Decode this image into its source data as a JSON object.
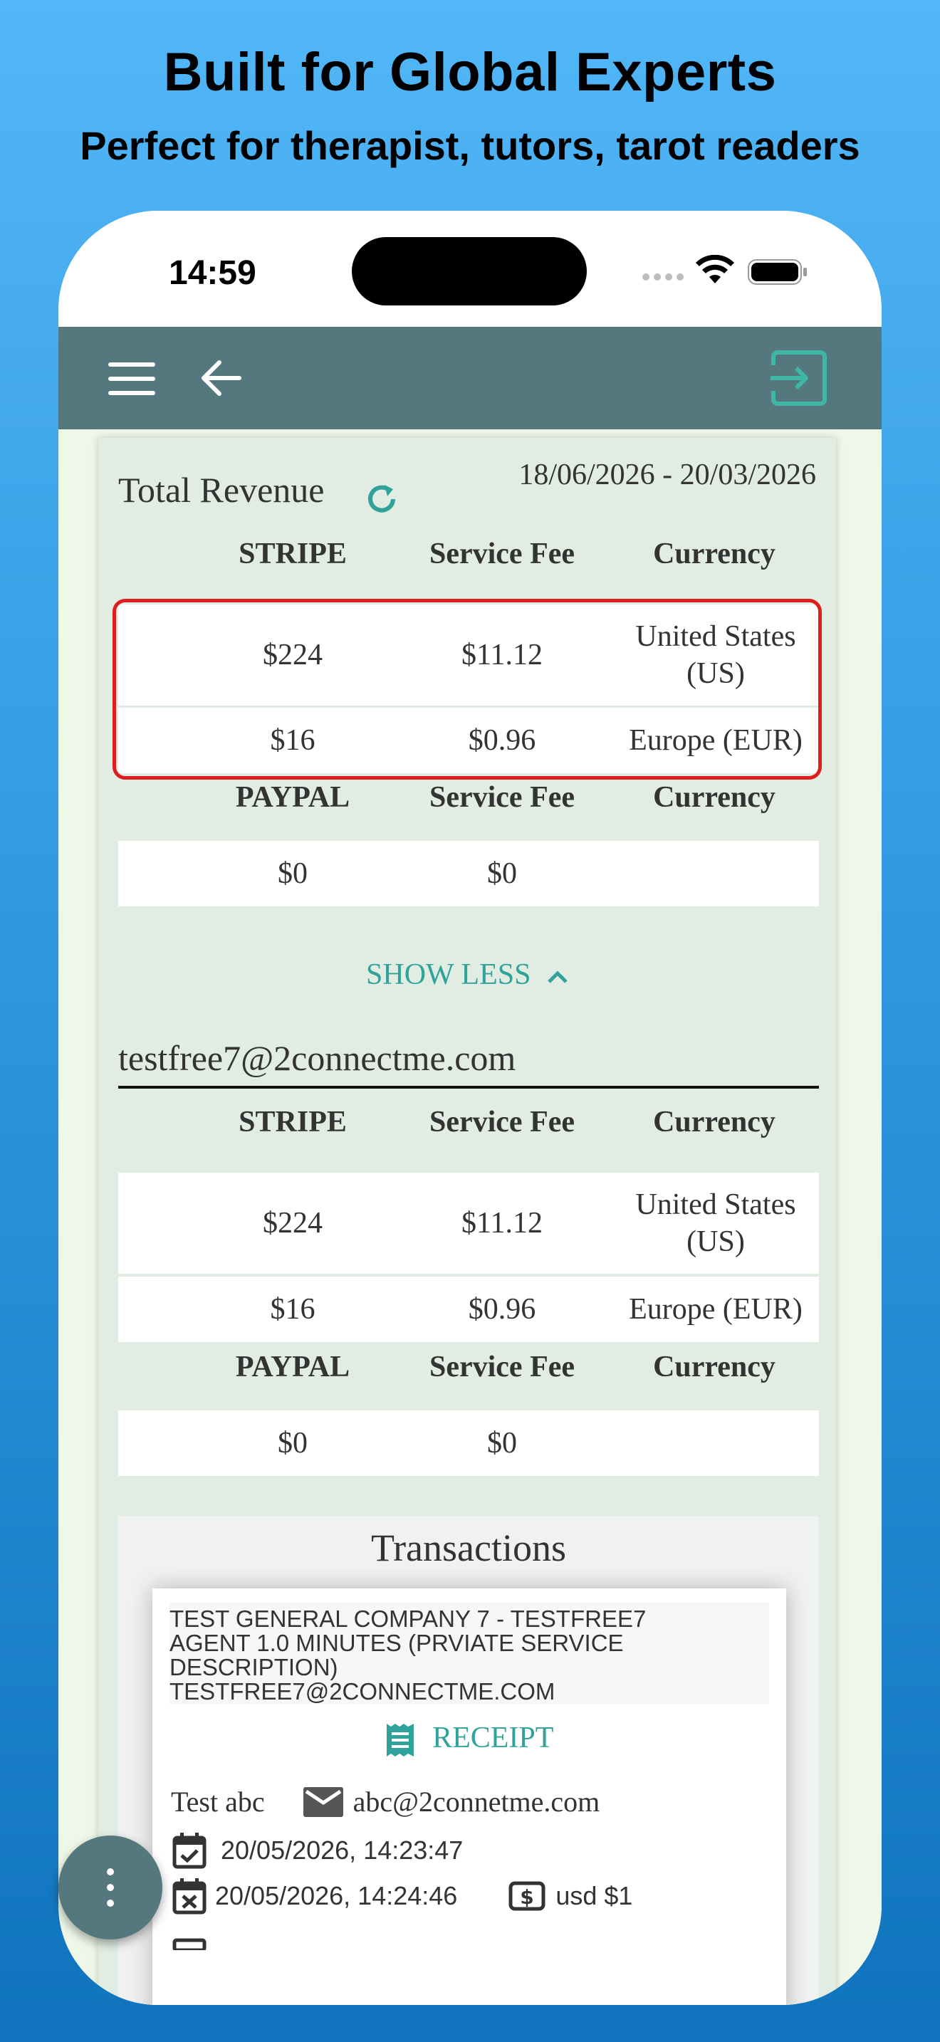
{
  "headline": "Built for Global Experts",
  "subheadline": "Perfect for therapist, tutors, tarot readers",
  "status_bar": {
    "time": "14:59"
  },
  "revenue": {
    "title": "Total Revenue",
    "date_range": "18/06/2026 - 20/03/2026",
    "stripe_header": {
      "provider": "STRIPE",
      "fee": "Service Fee",
      "currency": "Currency"
    },
    "stripe_rows": [
      {
        "amount": "$224",
        "fee": "$11.12",
        "currency": "United States (US)"
      },
      {
        "amount": "$16",
        "fee": "$0.96",
        "currency": "Europe (EUR)"
      }
    ],
    "paypal_header": {
      "provider": "PAYPAL",
      "fee": "Service Fee",
      "currency": "Currency"
    },
    "paypal_rows": [
      {
        "amount": "$0",
        "fee": "$0",
        "currency": ""
      }
    ],
    "show_less_label": "SHOW LESS"
  },
  "account": {
    "email": "testfree7@2connectme.com",
    "stripe_header": {
      "provider": "STRIPE",
      "fee": "Service Fee",
      "currency": "Currency"
    },
    "stripe_rows": [
      {
        "amount": "$224",
        "fee": "$11.12",
        "currency": "United States (US)"
      },
      {
        "amount": "$16",
        "fee": "$0.96",
        "currency": "Europe (EUR)"
      }
    ],
    "paypal_header": {
      "provider": "PAYPAL",
      "fee": "Service Fee",
      "currency": "Currency"
    },
    "paypal_rows": [
      {
        "amount": "$0",
        "fee": "$0",
        "currency": ""
      }
    ]
  },
  "transactions": {
    "title": "Transactions",
    "items": [
      {
        "description_lines": [
          "TEST GENERAL COMPANY 7 - TESTFREE7",
          "AGENT 1.0 MINUTES (PRVIATE SERVICE",
          "DESCRIPTION)",
          "TESTFREE7@2CONNECTME.COM"
        ],
        "receipt_label": "RECEIPT",
        "client_name": "Test abc",
        "client_email": "abc@2connetme.com",
        "start_time": "20/05/2026, 14:23:47",
        "end_time": "20/05/2026, 14:24:46",
        "amount": "usd $1"
      }
    ]
  },
  "colors": {
    "app_bar": "#55787e",
    "accent": "#2fa39a",
    "highlight_border": "#e01d1d",
    "card_bg": "#e1ede2",
    "page_bg": "#eef7e8"
  }
}
